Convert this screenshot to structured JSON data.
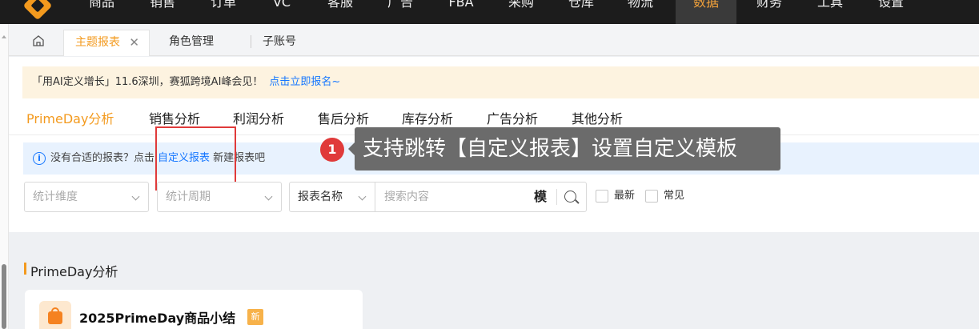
{
  "top_nav": {
    "items": [
      "商品",
      "销售",
      "订单",
      "VC",
      "客服",
      "广告",
      "FBA",
      "采购",
      "仓库",
      "物流",
      "数据",
      "财务",
      "工具",
      "设置"
    ],
    "active": "数据"
  },
  "tabbar": {
    "tabs": [
      {
        "label": "主题报表",
        "active": true
      },
      {
        "label": "角色管理"
      },
      {
        "label": "子账号"
      }
    ],
    "close_glyph": "✕"
  },
  "banner": {
    "text": "「用AI定义增长」11.6深圳，赛狐跨境AI峰会见！",
    "link": "点击立即报名~"
  },
  "subtabs": [
    "PrimeDay分析",
    "销售分析",
    "利润分析",
    "售后分析",
    "库存分析",
    "广告分析",
    "其他分析"
  ],
  "info": {
    "prefix": "没有合适的报表？点击",
    "link": "自定义报表",
    "suffix": "新建报表吧"
  },
  "tooltip": {
    "step": "1",
    "text": "支持跳转【自定义报表】设置自定义模板"
  },
  "filters": {
    "dimension_placeholder": "统计维度",
    "period_placeholder": "统计周期",
    "report_select": "报表名称",
    "search_placeholder": "搜索内容",
    "mo_label": "模",
    "check_latest": "最新",
    "check_common": "常见"
  },
  "section": {
    "title": "PrimeDay分析",
    "card_title": "2025PrimeDay商品小结",
    "new_badge": "新"
  },
  "colors": {
    "accent": "#f39a1e",
    "link": "#1677ff",
    "highlight": "#e03a3a"
  }
}
